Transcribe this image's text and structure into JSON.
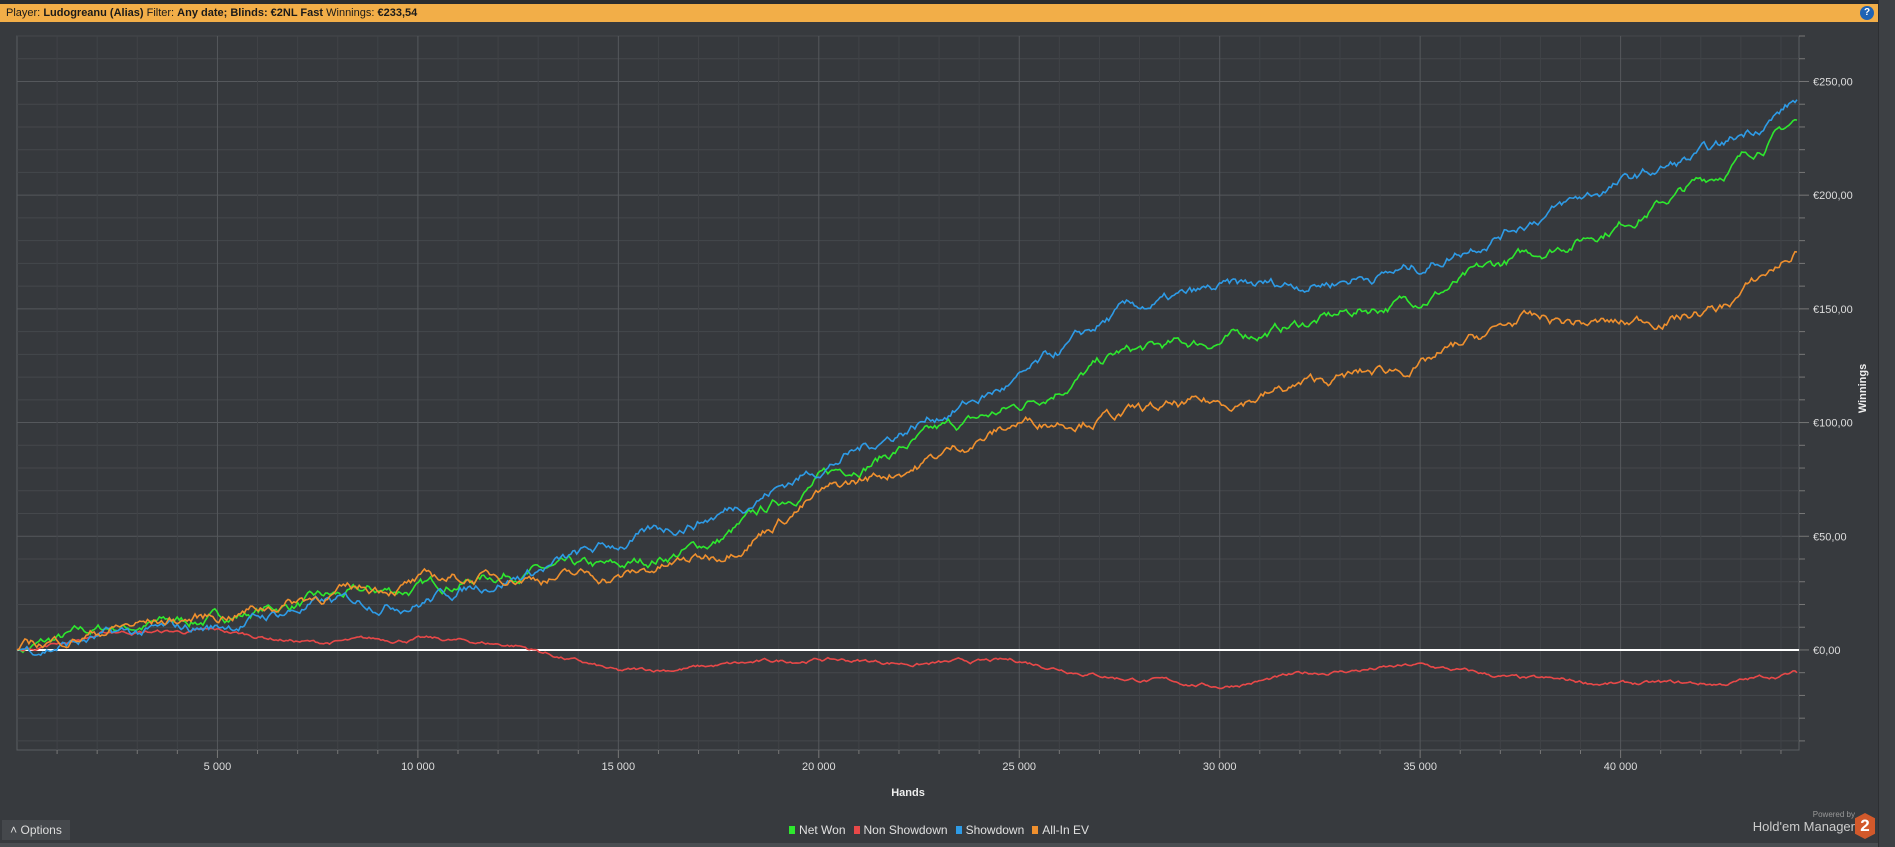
{
  "header": {
    "player_label": "Player:",
    "player": "Ludogreanu (Alias)",
    "filter_label": "Filter:",
    "filter": "Any date; Blinds: €2NL Fast",
    "winnings_label": "Winnings:",
    "winnings": "€233,54",
    "help": "?"
  },
  "options_label": "Options",
  "brand": {
    "powered": "Powered by",
    "name": "Hold'em Manager",
    "logo": "2"
  },
  "colors": {
    "net_won": "#2ee82e",
    "non_showdown": "#e84848",
    "showdown": "#2e9be6",
    "allin_ev": "#f0902e"
  },
  "chart_data": {
    "type": "line",
    "xlabel": "Hands",
    "ylabel": "Winnings",
    "xlim": [
      0,
      44450
    ],
    "ylim": [
      -44,
      270
    ],
    "x_ticks": [
      5000,
      10000,
      15000,
      20000,
      25000,
      30000,
      35000,
      40000
    ],
    "x_tick_labels": [
      "5 000",
      "10 000",
      "15 000",
      "20 000",
      "25 000",
      "30 000",
      "35 000",
      "40 000"
    ],
    "y_ticks": [
      0,
      50,
      100,
      150,
      200,
      250
    ],
    "y_tick_labels": [
      "€0,00",
      "€50,00",
      "€100,00",
      "€150,00",
      "€200,00",
      "€250,00"
    ],
    "grid": true,
    "legend": "bottom-center",
    "x": [
      0,
      2500,
      5000,
      7500,
      10000,
      12500,
      15000,
      17500,
      20000,
      22500,
      25000,
      27500,
      30000,
      32500,
      35000,
      37500,
      40000,
      42500,
      44400
    ],
    "series": [
      {
        "name": "Net Won",
        "key": "net_won",
        "values": [
          0,
          10,
          14,
          22,
          27,
          35,
          35,
          48,
          75,
          92,
          107,
          130,
          136,
          145,
          155,
          172,
          188,
          210,
          233
        ]
      },
      {
        "name": "Non Showdown",
        "key": "non_showdown",
        "values": [
          0,
          8,
          8,
          3,
          5,
          2,
          -10,
          -7,
          -4,
          -6,
          -5,
          -12,
          -16,
          -10,
          -7,
          -13,
          -15,
          -15,
          -10
        ]
      },
      {
        "name": "Showdown",
        "key": "showdown",
        "values": [
          0,
          6,
          10,
          20,
          22,
          33,
          46,
          60,
          80,
          100,
          118,
          148,
          158,
          162,
          168,
          188,
          205,
          220,
          242
        ]
      },
      {
        "name": "All-In EV",
        "key": "allin_ev",
        "values": [
          0,
          10,
          15,
          24,
          30,
          33,
          32,
          42,
          68,
          82,
          100,
          104,
          108,
          118,
          125,
          145,
          143,
          150,
          175
        ]
      }
    ]
  }
}
